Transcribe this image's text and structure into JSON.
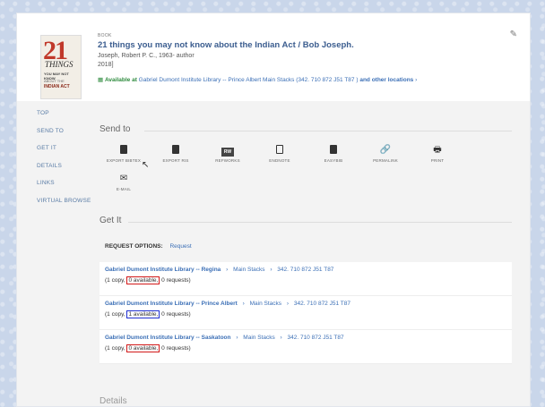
{
  "record": {
    "type": "BOOK",
    "title": "21 things you may not know about the Indian Act / Bob Joseph.",
    "author": "Joseph, Robert P. C., 1963- author",
    "year": "2018]",
    "availability_status": "Available at",
    "availability_location": "Gabriel Dumont Institute Library -- Prince Albert  Main Stacks (342. 710 872 J51 T87 )",
    "availability_more": "and other locations",
    "cover": {
      "number": "21",
      "word": "THINGS",
      "line1": "YOU MAY NOT KNOW",
      "line2": "ABOUT THE",
      "line3": "INDIAN ACT"
    }
  },
  "nav": {
    "items": [
      "TOP",
      "SEND TO",
      "GET IT",
      "DETAILS",
      "LINKS",
      "VIRTUAL BROWSE"
    ]
  },
  "send_to": {
    "title": "Send to",
    "actions": [
      {
        "label": "EXPORT BIBTEX",
        "icon": "export-bibtex-icon"
      },
      {
        "label": "EXPORT RIS",
        "icon": "export-ris-icon"
      },
      {
        "label": "REFWORKS",
        "icon": "refworks-icon",
        "glyph": "RW"
      },
      {
        "label": "ENDNOTE",
        "icon": "endnote-icon"
      },
      {
        "label": "EASYBIB",
        "icon": "easybib-icon"
      },
      {
        "label": "PERMALINK",
        "icon": "permalink-icon",
        "glyph": "🔗"
      },
      {
        "label": "PRINT",
        "icon": "print-icon",
        "glyph": "🖶"
      },
      {
        "label": "E-MAIL",
        "icon": "email-icon",
        "glyph": "✉"
      }
    ]
  },
  "get_it": {
    "title": "Get It",
    "request_options_label": "REQUEST OPTIONS:",
    "request_link": "Request",
    "holdings": [
      {
        "library": "Gabriel Dumont Institute Library -- Regina",
        "collection": "Main Stacks",
        "call_number": "342. 710 872 J51 T87",
        "copies": "(1 copy,",
        "available": "0 available,",
        "requests": "0 requests)",
        "highlight": "#d21919"
      },
      {
        "library": "Gabriel Dumont Institute Library -- Prince Albert",
        "collection": "Main Stacks",
        "call_number": "342. 710 872 J51 T87",
        "copies": "(1 copy,",
        "available": "1 available,",
        "requests": "0 requests)",
        "highlight": "#1f2fd0"
      },
      {
        "library": "Gabriel Dumont Institute Library -- Saskatoon",
        "collection": "Main Stacks",
        "call_number": "342. 710 872 J51 T87",
        "copies": "(1 copy,",
        "available": "0 available,",
        "requests": "0 requests)",
        "highlight": "#d21919"
      }
    ]
  },
  "details": {
    "title": "Details"
  },
  "colors": {
    "link": "#3b6fb6",
    "title": "#3b5d8f",
    "available_green": "#2e8b3e",
    "highlight_red": "#d21919",
    "highlight_blue": "#1f2fd0",
    "page_background": "#c9d6ea"
  }
}
